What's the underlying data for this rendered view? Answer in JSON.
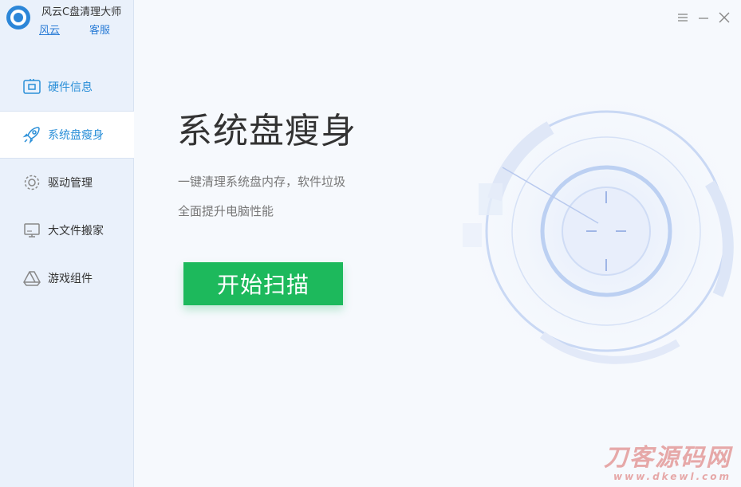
{
  "app": {
    "title": "风云C盘清理大师",
    "link_brand": "风云",
    "link_support": "客服"
  },
  "sidebar": {
    "items": [
      {
        "label": "硬件信息",
        "icon": "hardware-icon"
      },
      {
        "label": "系统盘瘦身",
        "icon": "rocket-icon"
      },
      {
        "label": "驱动管理",
        "icon": "gear-icon"
      },
      {
        "label": "大文件搬家",
        "icon": "monitor-icon"
      },
      {
        "label": "游戏组件",
        "icon": "drive-icon"
      }
    ],
    "active_index": 1
  },
  "window_controls": {
    "menu": "menu-icon",
    "minimize": "minimize-icon",
    "close": "close-icon"
  },
  "main": {
    "headline": "系统盘瘦身",
    "desc_line1": "一键清理系统盘内存，软件垃圾",
    "desc_line2": "全面提升电脑性能",
    "scan_button": "开始扫描"
  },
  "watermark": {
    "main": "刀客源码网",
    "sub": "www.dkewl.com"
  },
  "colors": {
    "accent": "#2a8fd8",
    "button": "#1db95c",
    "sidebar_bg": "#eaf1fb",
    "content_bg": "#f6f9fd"
  }
}
